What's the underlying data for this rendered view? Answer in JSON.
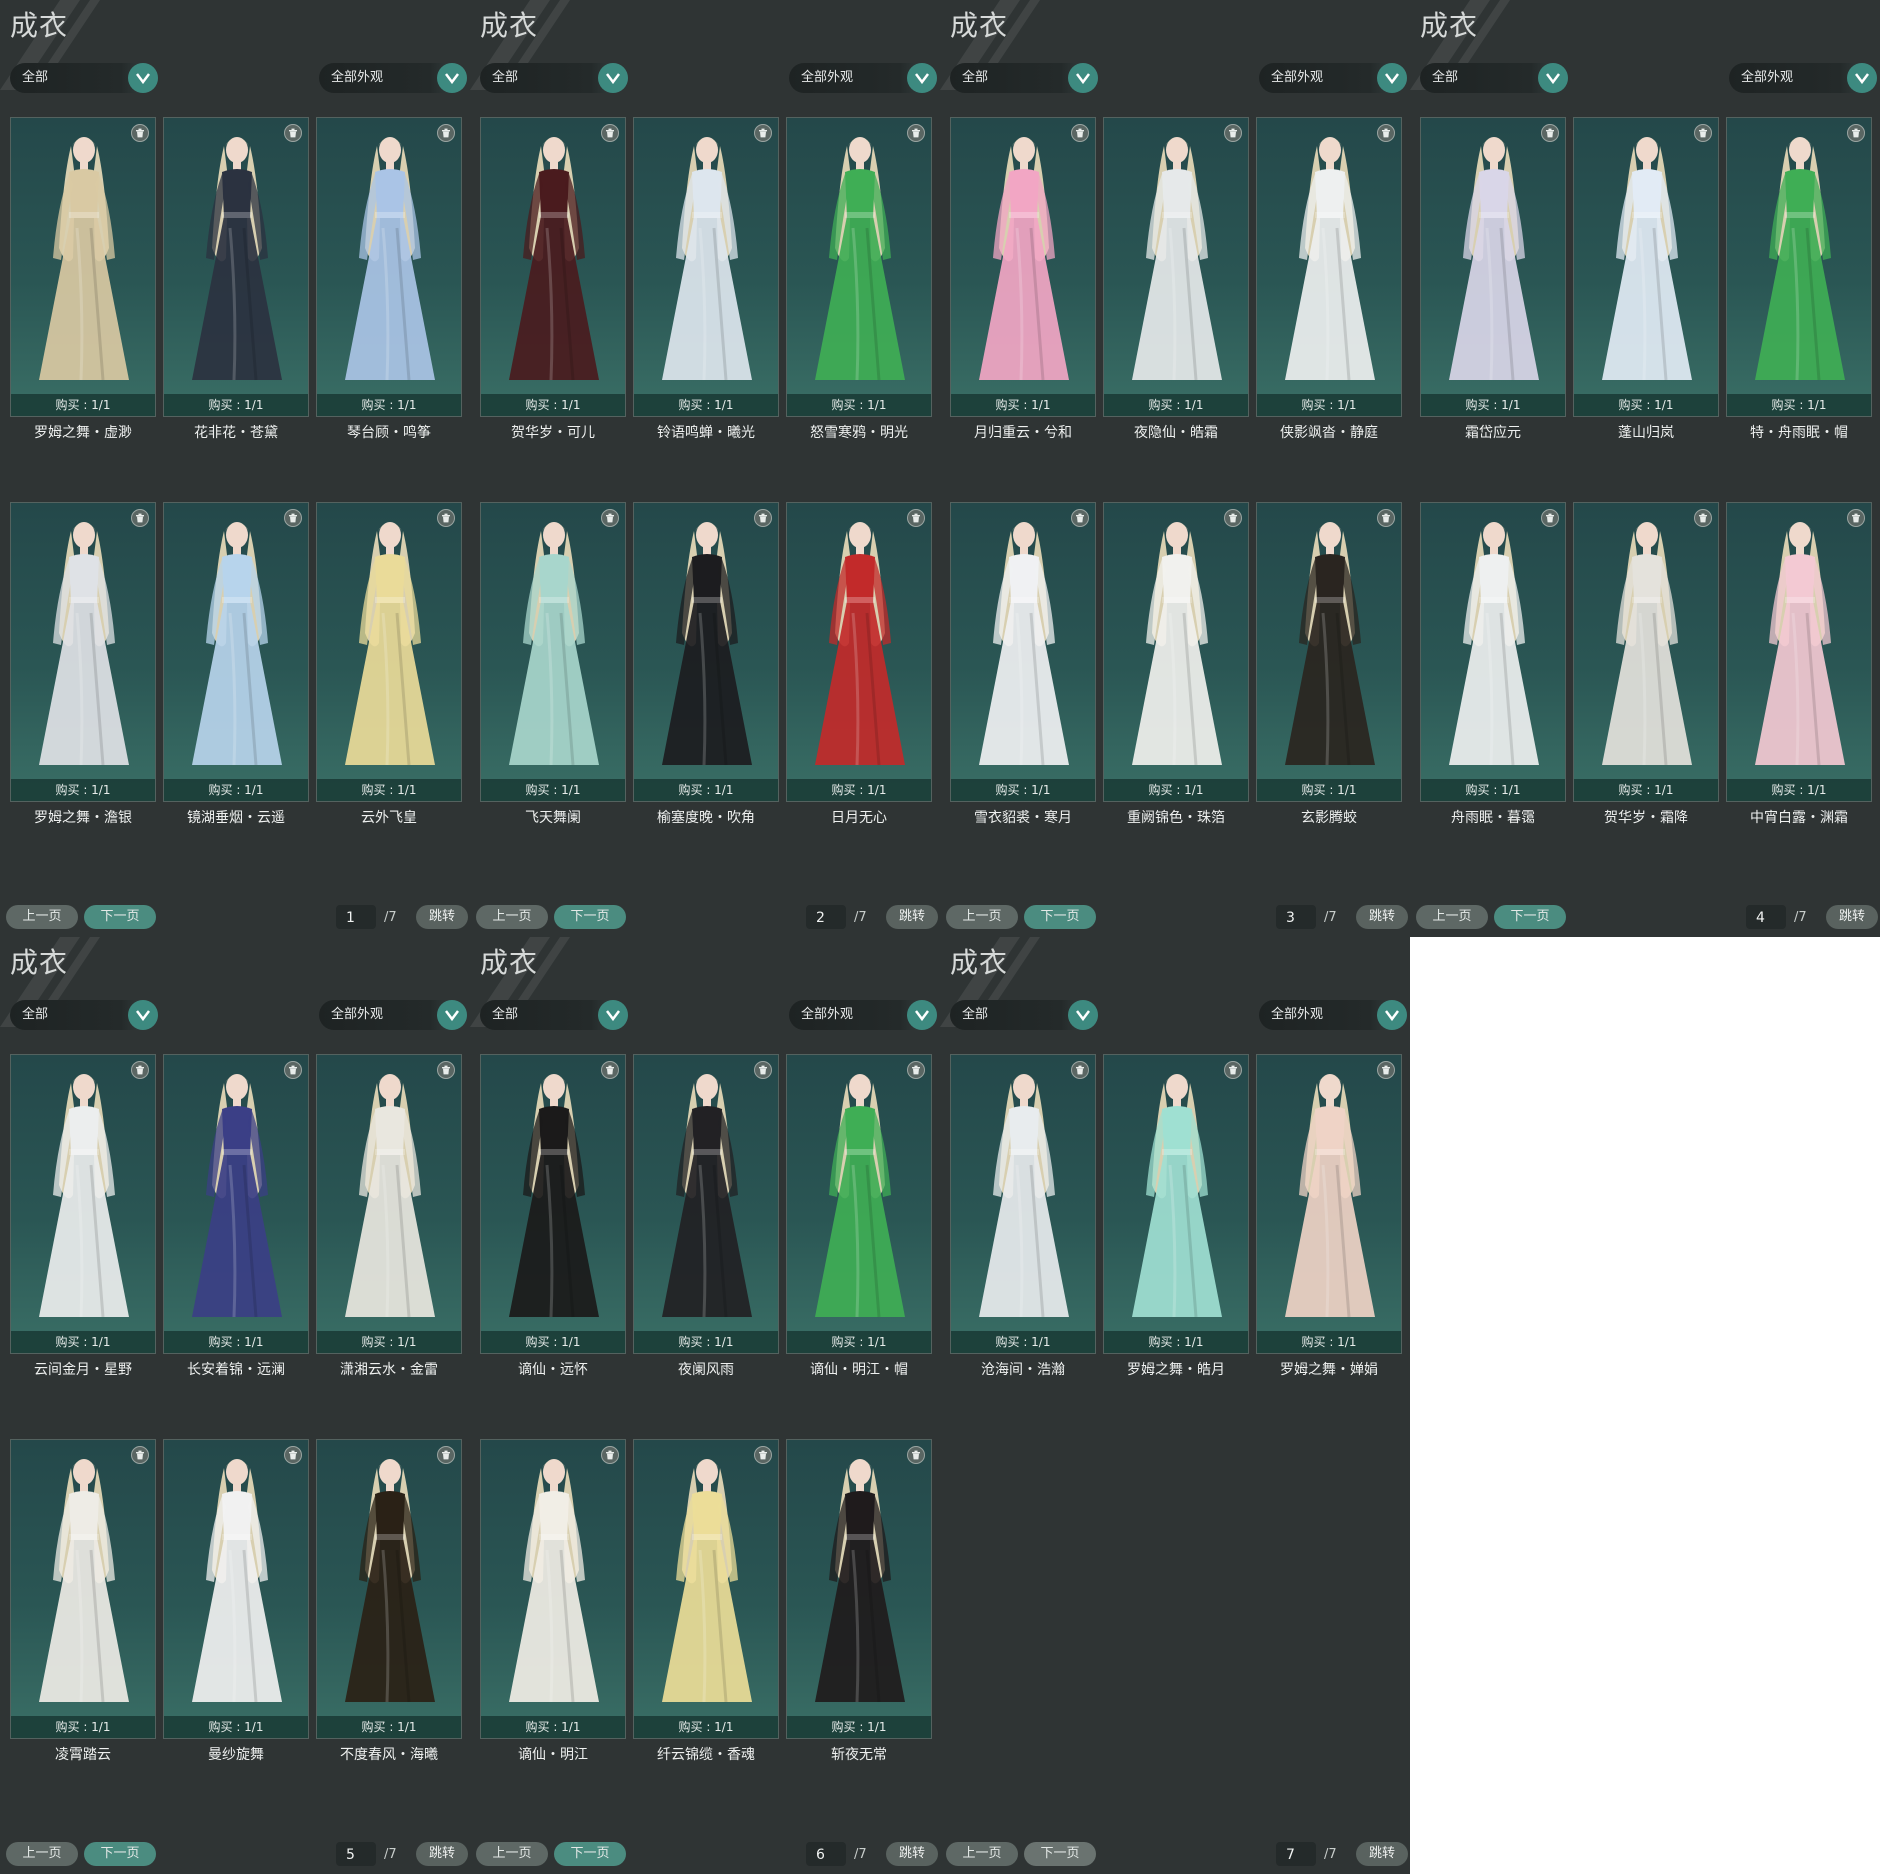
{
  "labels": {
    "title": "成衣",
    "filter_all": "全部",
    "filter_looks": "全部外观",
    "prev": "上一页",
    "next": "下一页",
    "jump": "跳转",
    "buy": "购买 : 1/1",
    "total": "/7"
  },
  "colors": {
    "accent": "#3d8a80",
    "panel_bg": "#2f3434",
    "card_bg": "#2a5654"
  },
  "pages": [
    {
      "page_number": "1",
      "items": [
        {
          "name": "罗姆之舞・虚渺",
          "dress": "#d9c9a3"
        },
        {
          "name": "花非花・苍黛",
          "dress": "#2b3240"
        },
        {
          "name": "琴台顾・鸣筝",
          "dress": "#aac4e6"
        },
        {
          "name": "罗姆之舞・澹银",
          "dress": "#dfe2e6"
        },
        {
          "name": "镜湖垂烟・云遥",
          "dress": "#b7d4ec"
        },
        {
          "name": "云外飞皇",
          "dress": "#eadb99"
        }
      ]
    },
    {
      "page_number": "2",
      "items": [
        {
          "name": "贺华岁・可儿",
          "dress": "#4a1b1e"
        },
        {
          "name": "铃语鸣蝉・曦光",
          "dress": "#dde6ee"
        },
        {
          "name": "怒雪寒鸦・明光",
          "dress": "#3fae55"
        },
        {
          "name": "飞天舞阑",
          "dress": "#a8d6cc"
        },
        {
          "name": "榆塞度晚・吹角",
          "dress": "#1c1c1f"
        },
        {
          "name": "日月无心",
          "dress": "#c22a2a"
        }
      ]
    },
    {
      "page_number": "3",
      "items": [
        {
          "name": "月归重云・兮和",
          "dress": "#f2a6c4"
        },
        {
          "name": "夜隐仙・皓霜",
          "dress": "#e6e9ea"
        },
        {
          "name": "侠影飒沓・静庭",
          "dress": "#eef0f0"
        },
        {
          "name": "雪衣貂裘・寒月",
          "dress": "#f0f1f3"
        },
        {
          "name": "重阙锦色・珠箔",
          "dress": "#f1f1ee"
        },
        {
          "name": "玄影腾蛟",
          "dress": "#2a2520"
        }
      ]
    },
    {
      "page_number": "4",
      "items": [
        {
          "name": "霜岱应元",
          "dress": "#d9d6e8"
        },
        {
          "name": "蓬山归岚",
          "dress": "#e2ebf5"
        },
        {
          "name": "特・舟雨眠・帽",
          "dress": "#3fae55"
        },
        {
          "name": "舟雨眠・暮霭",
          "dress": "#eef0f0"
        },
        {
          "name": "贺华岁・霜降",
          "dress": "#e4e2dc"
        },
        {
          "name": "中宵白露・渊霜",
          "dress": "#f3c9d3"
        }
      ]
    },
    {
      "page_number": "5",
      "items": [
        {
          "name": "云间金月・星野",
          "dress": "#eceeee"
        },
        {
          "name": "长安着锦・远澜",
          "dress": "#3b3f86"
        },
        {
          "name": "潇湘云水・金雷",
          "dress": "#e9e7df"
        },
        {
          "name": "凌霄踏云",
          "dress": "#eeece6"
        },
        {
          "name": "曼纱旋舞",
          "dress": "#f1f1f1"
        },
        {
          "name": "不度春风・海曦",
          "dress": "#2a2116"
        }
      ]
    },
    {
      "page_number": "6",
      "items": [
        {
          "name": "谪仙・远怀",
          "dress": "#1b1a1a"
        },
        {
          "name": "夜阑风雨",
          "dress": "#222124"
        },
        {
          "name": "谪仙・明江・帽",
          "dress": "#3fae55"
        },
        {
          "name": "谪仙・明江",
          "dress": "#f1eee6"
        },
        {
          "name": "纤云锦缆・香魂",
          "dress": "#ecdd98"
        },
        {
          "name": "斩夜无常",
          "dress": "#1f1b1c"
        }
      ]
    },
    {
      "page_number": "7",
      "items": [
        {
          "name": "沧海间・浩瀚",
          "dress": "#e8ecee"
        },
        {
          "name": "罗姆之舞・皓月",
          "dress": "#9fe0d2"
        },
        {
          "name": "罗姆之舞・婵娟",
          "dress": "#efd3c6"
        }
      ]
    }
  ]
}
